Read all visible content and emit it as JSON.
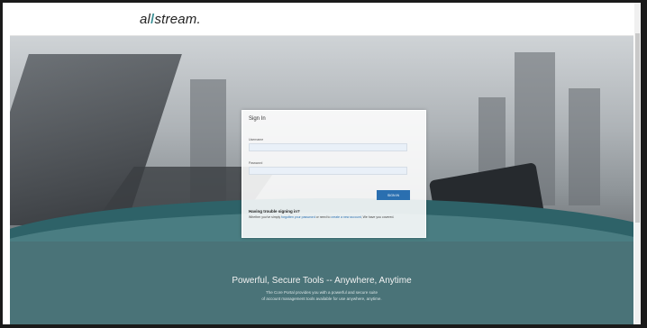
{
  "logo": {
    "left": "al",
    "slash": "/",
    "right": "stream."
  },
  "signin": {
    "title": "Sign In",
    "username_label": "Username",
    "password_label": "Password",
    "button": "SIGN IN",
    "trouble_heading": "Having trouble signing in?",
    "help_prefix": "Whether you've simply",
    "help_link1": "forgotten your password",
    "help_mid": "or need to",
    "help_link2": "create a new account",
    "help_suffix": ", We have you covered."
  },
  "promo": {
    "title": "Powerful, Secure Tools -- Anywhere, Anytime",
    "line1": "The Core Portal provides you with a powerful and secure suite",
    "line2": "of account management tools available for use anywhere, anytime."
  },
  "colors": {
    "teal": "#4a7378",
    "button": "#2a6fb0",
    "link": "#2a6fb0"
  }
}
